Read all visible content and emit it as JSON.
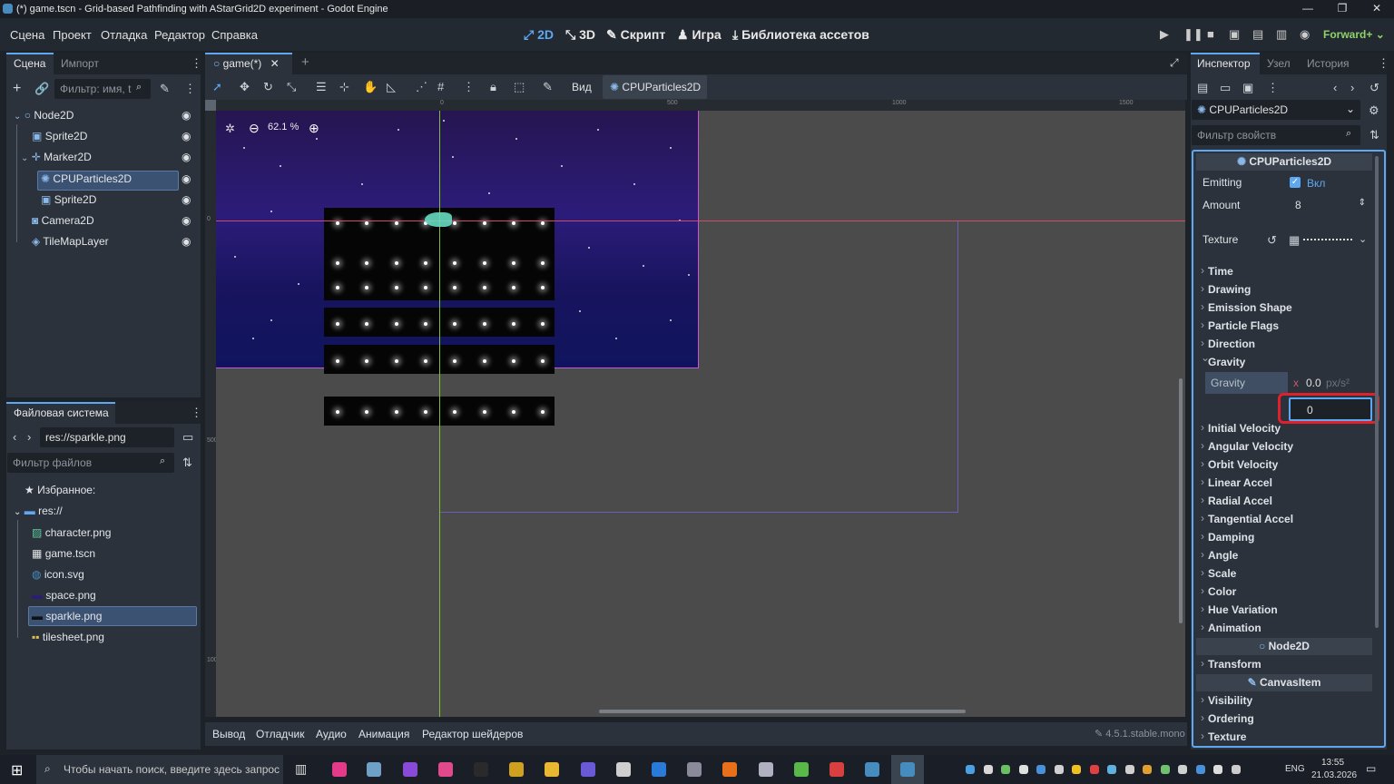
{
  "window": {
    "title": "(*) game.tscn - Grid-based Pathfinding with AStarGrid2D experiment - Godot Engine"
  },
  "menu": [
    "Сцена",
    "Проект",
    "Отладка",
    "Редактор",
    "Справка"
  ],
  "workspaces": {
    "w2d": "2D",
    "w3d": "3D",
    "script": "Скрипт",
    "game": "Игра",
    "assetlib": "Библиотека ассетов"
  },
  "renderer": "Forward+",
  "scene_dock": {
    "tab_scene": "Сцена",
    "tab_import": "Импорт",
    "filter_placeholder": "Фильтр: имя, t",
    "nodes": [
      "Node2D",
      "Sprite2D",
      "Marker2D",
      "CPUParticles2D",
      "Sprite2D",
      "Camera2D",
      "TileMapLayer"
    ]
  },
  "fs_dock": {
    "tab": "Файловая система",
    "path": "res://sparkle.png",
    "filter_placeholder": "Фильтр файлов",
    "favorites": "Избранное:",
    "root": "res://",
    "files": [
      "character.png",
      "game.tscn",
      "icon.svg",
      "space.png",
      "sparkle.png",
      "tilesheet.png"
    ]
  },
  "editor": {
    "tab": "game(*)",
    "view_menu": "Вид",
    "selected_node": "CPUParticles2D",
    "zoom": "62.1 %",
    "ruler_labels": [
      "0",
      "500",
      "1000",
      "1500"
    ],
    "vruler_labels": [
      "0",
      "500",
      "1000"
    ]
  },
  "bottom": {
    "tabs": [
      "Вывод",
      "Отладчик",
      "Аудио",
      "Анимация",
      "Редактор шейдеров"
    ],
    "version": "4.5.1.stable.mono"
  },
  "inspector": {
    "tab_inspector": "Инспектор",
    "tab_node": "Узел",
    "tab_history": "История",
    "object": "CPUParticles2D",
    "filter_placeholder": "Фильтр свойств",
    "class_header": "CPUParticles2D",
    "emitting_label": "Emitting",
    "emitting_value": "Вкл",
    "amount_label": "Amount",
    "amount_value": "8",
    "texture_label": "Texture",
    "gravity_label": "Gravity",
    "gravity_axis": "x",
    "gravity_value": "0.0",
    "gravity_unit": "px/s²",
    "edit_value": "0",
    "sections_a": [
      "Time",
      "Drawing",
      "Emission Shape",
      "Particle Flags",
      "Direction",
      "Gravity"
    ],
    "sections_b": [
      "Initial Velocity",
      "Angular Velocity",
      "Orbit Velocity",
      "Linear Accel",
      "Radial Accel",
      "Tangential Accel",
      "Damping",
      "Angle",
      "Scale",
      "Color",
      "Hue Variation",
      "Animation"
    ],
    "node2d_header": "Node2D",
    "transform": "Transform",
    "canvasitem_header": "CanvasItem",
    "sections_c": [
      "Visibility",
      "Ordering",
      "Texture"
    ]
  },
  "taskbar": {
    "search": "Чтобы начать поиск, введите здесь запрос",
    "lang": "ENG",
    "time": "13:55",
    "date": "21.03.2026"
  }
}
